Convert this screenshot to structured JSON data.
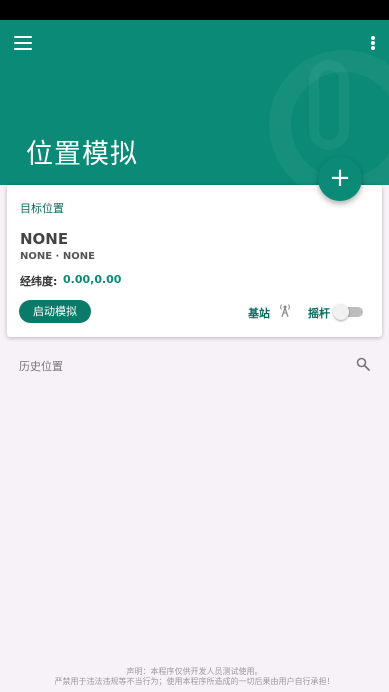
{
  "header": {
    "title": "位置模拟",
    "background_color": "#0a8a77"
  },
  "fab": {
    "label": "+"
  },
  "card": {
    "target_label": "目标位置",
    "location_name": "NONE",
    "location_sub": "NONE · NONE",
    "latlng_label": "经纬度:",
    "latlng_value": "0.00,0.00",
    "start_button": "启动模拟",
    "station_label": "基站",
    "joystick_label": "摇杆",
    "joystick_toggle_on": false
  },
  "history": {
    "label": "历史位置"
  },
  "footer": {
    "line1": "声明：本程序仅供开发人员测试使用。",
    "line2": "严禁用于违法违规等不当行为；使用本程序所造成的一切后果由用户自行承担！"
  },
  "icons": {
    "menu": "menu-icon",
    "more": "more-vert-icon",
    "antenna": "antenna-icon",
    "search": "search-icon"
  }
}
